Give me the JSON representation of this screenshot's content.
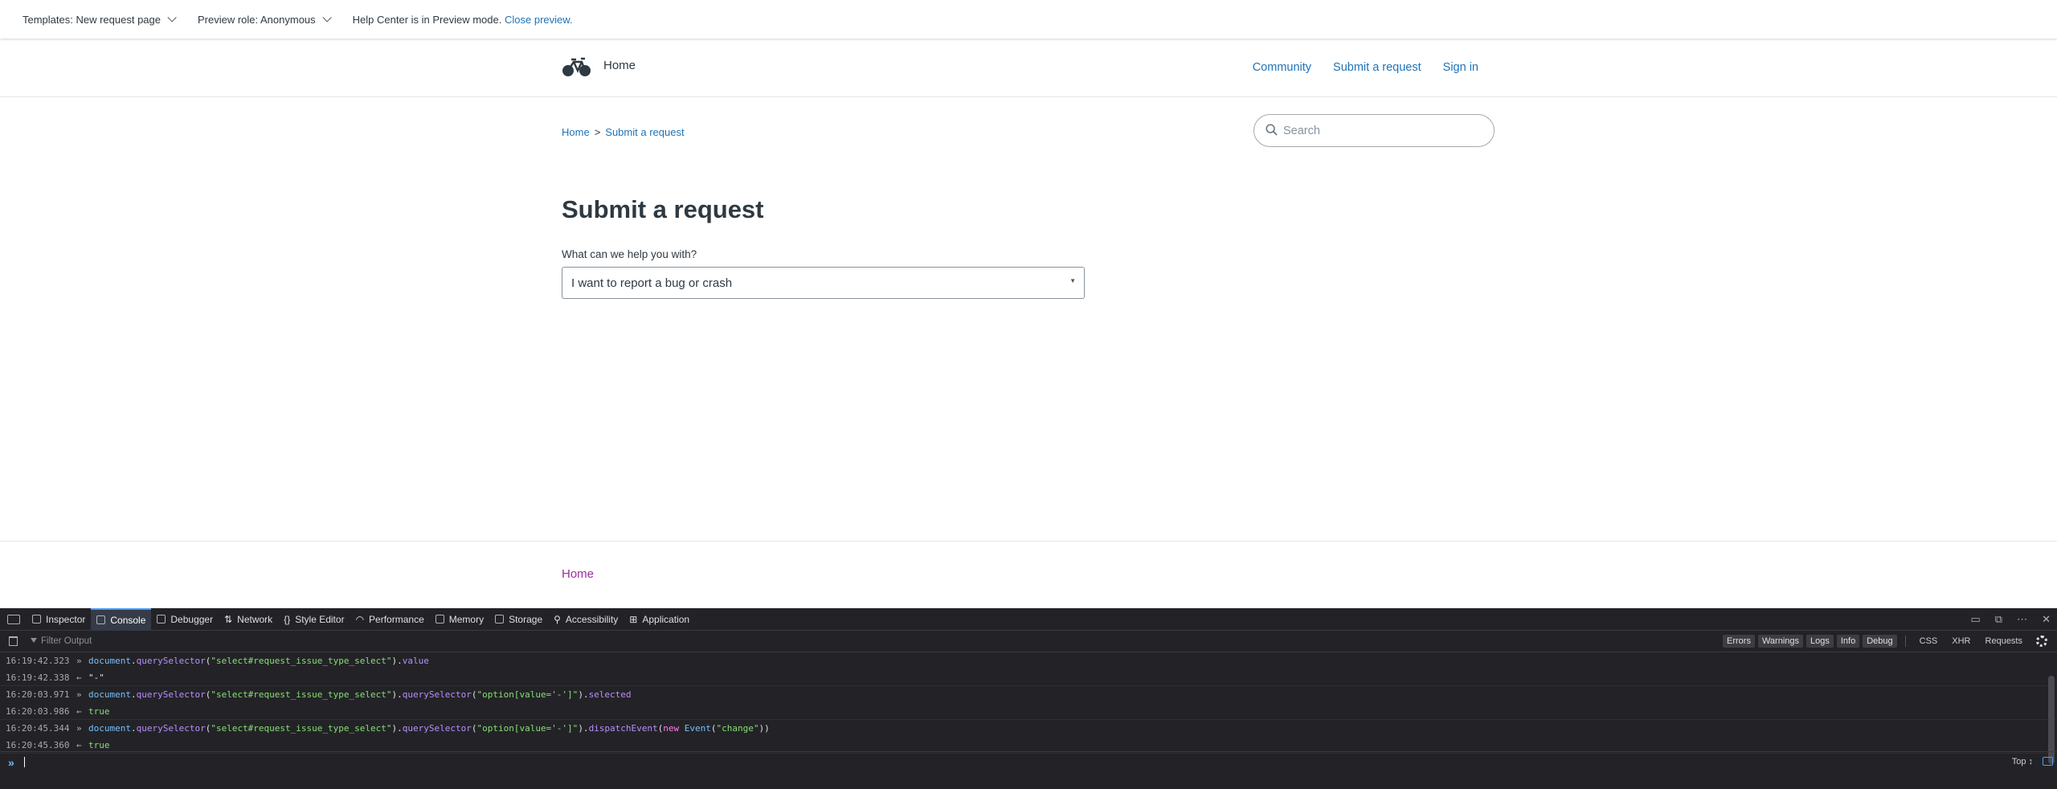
{
  "topbar": {
    "template_label": "Templates: New request page",
    "role_label": "Preview role: Anonymous",
    "notice_text": "Help Center is in Preview mode.",
    "close_preview": "Close preview."
  },
  "header": {
    "brand": "Home",
    "nav": [
      "Community",
      "Submit a request",
      "Sign in"
    ]
  },
  "breadcrumb": {
    "home": "Home",
    "separator": ">",
    "current": "Submit a request"
  },
  "search": {
    "placeholder": "Search"
  },
  "main": {
    "title": "Submit a request",
    "field_label": "What can we help you with?",
    "select_value": "I want to report a bug or crash"
  },
  "footer": {
    "home_link": "Home"
  },
  "devtools": {
    "tabs": [
      "Inspector",
      "Console",
      "Debugger",
      "Network",
      "Style Editor",
      "Performance",
      "Memory",
      "Storage",
      "Accessibility",
      "Application"
    ],
    "active_tab": "Console",
    "filter_placeholder": "Filter Output",
    "filters": [
      "Errors",
      "Warnings",
      "Logs",
      "Info",
      "Debug"
    ],
    "extra_filters": [
      "CSS",
      "XHR",
      "Requests"
    ],
    "context": "Top ↕",
    "console_lines": [
      {
        "time": "16:19:42.323",
        "dir": "in",
        "segments": [
          {
            "t": "document",
            "c": "c-fn"
          },
          {
            "t": ".",
            "c": "c-plain"
          },
          {
            "t": "querySelector",
            "c": "c-prop"
          },
          {
            "t": "(",
            "c": "c-plain"
          },
          {
            "t": "\"select#request_issue_type_select\"",
            "c": "c-str"
          },
          {
            "t": ").",
            "c": "c-plain"
          },
          {
            "t": "value",
            "c": "c-prop"
          }
        ]
      },
      {
        "time": "16:19:42.338",
        "dir": "out",
        "segments": [
          {
            "t": "\"-\"",
            "c": "c-plain"
          }
        ]
      },
      {
        "time": "16:20:03.971",
        "dir": "in",
        "segments": [
          {
            "t": "document",
            "c": "c-fn"
          },
          {
            "t": ".",
            "c": "c-plain"
          },
          {
            "t": "querySelector",
            "c": "c-prop"
          },
          {
            "t": "(",
            "c": "c-plain"
          },
          {
            "t": "\"select#request_issue_type_select\"",
            "c": "c-str"
          },
          {
            "t": ").",
            "c": "c-plain"
          },
          {
            "t": "querySelector",
            "c": "c-prop"
          },
          {
            "t": "(",
            "c": "c-plain"
          },
          {
            "t": "\"option[value='-']\"",
            "c": "c-str"
          },
          {
            "t": ").",
            "c": "c-plain"
          },
          {
            "t": "selected",
            "c": "c-prop"
          }
        ]
      },
      {
        "time": "16:20:03.986",
        "dir": "out",
        "segments": [
          {
            "t": "true",
            "c": "c-true"
          }
        ]
      },
      {
        "time": "16:20:45.344",
        "dir": "in",
        "segments": [
          {
            "t": "document",
            "c": "c-fn"
          },
          {
            "t": ".",
            "c": "c-plain"
          },
          {
            "t": "querySelector",
            "c": "c-prop"
          },
          {
            "t": "(",
            "c": "c-plain"
          },
          {
            "t": "\"select#request_issue_type_select\"",
            "c": "c-str"
          },
          {
            "t": ").",
            "c": "c-plain"
          },
          {
            "t": "querySelector",
            "c": "c-prop"
          },
          {
            "t": "(",
            "c": "c-plain"
          },
          {
            "t": "\"option[value='-']\"",
            "c": "c-str"
          },
          {
            "t": ").",
            "c": "c-plain"
          },
          {
            "t": "dispatchEvent",
            "c": "c-prop"
          },
          {
            "t": "(",
            "c": "c-plain"
          },
          {
            "t": "new ",
            "c": "c-kw"
          },
          {
            "t": "Event",
            "c": "c-fn"
          },
          {
            "t": "(",
            "c": "c-plain"
          },
          {
            "t": "\"change\"",
            "c": "c-str"
          },
          {
            "t": "))",
            "c": "c-plain"
          }
        ]
      },
      {
        "time": "16:20:45.360",
        "dir": "out",
        "segments": [
          {
            "t": "true",
            "c": "c-true"
          }
        ]
      }
    ]
  },
  "colors": {
    "link": "#1f73b7",
    "footer_link": "#9b2d9b",
    "devtools_bg": "#232327",
    "active_tab_accent": "#4d9df5"
  },
  "icons": {
    "logo": "bicycle-icon",
    "search": "search-icon",
    "settings": "gear-icon"
  }
}
